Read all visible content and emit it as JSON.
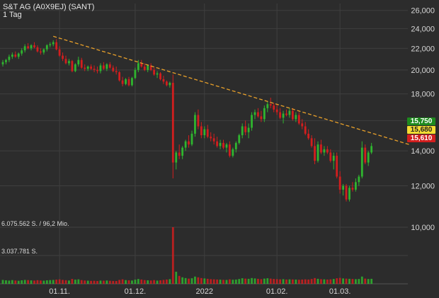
{
  "header": {
    "title": "S&T AG (A0X9EJ) (SANT)",
    "interval": "1 Tag"
  },
  "colors": {
    "background": "#2c2c2c",
    "grid": "#3f3f3f",
    "axis_text": "#d6d6d6",
    "up": "#2fb52f",
    "down": "#d21e1e",
    "trendline": "#e8a02a"
  },
  "price_tags": [
    {
      "label": "15,750",
      "bg": "#1e8a1e",
      "fg": "#ffffff"
    },
    {
      "label": "15,680",
      "bg": "#f5dc32",
      "fg": "#222222"
    },
    {
      "label": "15,610",
      "bg": "#d21e1e",
      "fg": "#ffffff"
    }
  ],
  "chart_data": {
    "type": "candlestick",
    "scale": "log",
    "title": "S&T AG (A0X9EJ) (SANT)",
    "interval": "1 Tag",
    "y_ticks": [
      "26,000",
      "24,000",
      "22,000",
      "20,000",
      "18,000",
      "16,000",
      "14,000",
      "12,000",
      "10,000"
    ],
    "y_tick_values": [
      26,
      24,
      22,
      20,
      18,
      16,
      14,
      12,
      10
    ],
    "ylim": [
      10,
      26.8
    ],
    "x_ticks": [
      "01.11.",
      "01.12.",
      "2022",
      "01.02.",
      "01.03."
    ],
    "x_tick_index": [
      18,
      42,
      64,
      87,
      107
    ],
    "volume_labels": [
      "6.075.562 S. / 96,2 Mio.",
      "3.037.781 S."
    ],
    "volume_max": 6075562,
    "trendline": {
      "from": {
        "i": 16,
        "price": 23.2
      },
      "to": {
        "i": 127,
        "price": 14.6
      }
    },
    "candles": [
      [
        20.5,
        20.9,
        20.3,
        20.7
      ],
      [
        20.7,
        21.0,
        20.5,
        20.9
      ],
      [
        20.9,
        21.4,
        20.7,
        21.2
      ],
      [
        21.2,
        21.6,
        21.0,
        21.4
      ],
      [
        21.4,
        21.7,
        21.1,
        21.2
      ],
      [
        21.2,
        21.6,
        21.0,
        21.5
      ],
      [
        21.5,
        22.0,
        21.3,
        21.8
      ],
      [
        21.8,
        22.4,
        21.6,
        22.2
      ],
      [
        22.2,
        22.5,
        21.9,
        22.0
      ],
      [
        22.0,
        22.4,
        21.8,
        22.3
      ],
      [
        22.3,
        22.6,
        22.0,
        22.1
      ],
      [
        22.1,
        22.3,
        21.6,
        21.7
      ],
      [
        21.7,
        22.0,
        21.4,
        21.6
      ],
      [
        21.6,
        22.0,
        21.4,
        21.9
      ],
      [
        21.9,
        22.4,
        21.7,
        22.3
      ],
      [
        22.3,
        22.6,
        22.1,
        22.4
      ],
      [
        22.4,
        22.8,
        22.2,
        22.6
      ],
      [
        22.6,
        22.9,
        21.8,
        21.9
      ],
      [
        21.9,
        22.2,
        21.2,
        21.3
      ],
      [
        21.3,
        21.6,
        20.8,
        21.0
      ],
      [
        21.0,
        21.3,
        20.5,
        20.6
      ],
      [
        20.6,
        21.0,
        20.4,
        20.8
      ],
      [
        20.8,
        20.9,
        19.8,
        19.9
      ],
      [
        19.9,
        20.6,
        19.8,
        20.5
      ],
      [
        20.5,
        21.2,
        20.3,
        20.9
      ],
      [
        20.9,
        21.1,
        20.1,
        20.2
      ],
      [
        20.2,
        20.5,
        19.9,
        20.1
      ],
      [
        20.1,
        20.4,
        19.9,
        20.3
      ],
      [
        20.3,
        20.5,
        20.0,
        20.1
      ],
      [
        20.1,
        20.4,
        19.8,
        20.0
      ],
      [
        20.0,
        20.3,
        19.7,
        19.9
      ],
      [
        19.9,
        20.6,
        19.7,
        20.4
      ],
      [
        20.4,
        20.7,
        20.0,
        20.1
      ],
      [
        20.1,
        20.6,
        19.9,
        20.5
      ],
      [
        20.5,
        20.7,
        20.1,
        20.2
      ],
      [
        20.2,
        20.4,
        19.8,
        19.9
      ],
      [
        19.9,
        20.3,
        19.6,
        19.8
      ],
      [
        19.8,
        19.9,
        19.0,
        19.1
      ],
      [
        19.1,
        19.4,
        18.6,
        18.8
      ],
      [
        18.8,
        19.3,
        18.7,
        19.2
      ],
      [
        19.2,
        19.4,
        18.6,
        18.7
      ],
      [
        18.7,
        19.4,
        18.6,
        19.3
      ],
      [
        19.3,
        20.2,
        19.2,
        20.0
      ],
      [
        20.0,
        20.9,
        19.8,
        20.6
      ],
      [
        20.6,
        20.9,
        20.2,
        20.3
      ],
      [
        20.3,
        20.6,
        19.9,
        20.0
      ],
      [
        20.0,
        20.5,
        19.8,
        20.4
      ],
      [
        20.4,
        20.6,
        19.9,
        20.0
      ],
      [
        20.0,
        20.2,
        19.5,
        19.6
      ],
      [
        19.6,
        19.9,
        19.3,
        19.7
      ],
      [
        19.7,
        19.8,
        19.1,
        19.2
      ],
      [
        19.2,
        19.5,
        18.8,
        19.0
      ],
      [
        19.0,
        19.1,
        18.6,
        18.7
      ],
      [
        18.7,
        19.0,
        18.5,
        18.9
      ],
      [
        18.9,
        19.6,
        12.4,
        13.3
      ],
      [
        13.3,
        14.0,
        12.9,
        13.9
      ],
      [
        13.9,
        14.4,
        13.5,
        13.7
      ],
      [
        13.7,
        14.3,
        13.5,
        14.2
      ],
      [
        14.2,
        14.7,
        14.0,
        14.6
      ],
      [
        14.6,
        15.0,
        14.2,
        14.4
      ],
      [
        14.4,
        15.3,
        14.3,
        15.1
      ],
      [
        15.1,
        16.6,
        14.9,
        16.4
      ],
      [
        16.4,
        16.8,
        15.4,
        15.6
      ],
      [
        15.6,
        15.9,
        14.8,
        15.0
      ],
      [
        15.0,
        15.6,
        14.8,
        15.4
      ],
      [
        15.4,
        15.7,
        14.8,
        14.9
      ],
      [
        14.9,
        15.2,
        14.6,
        14.8
      ],
      [
        14.8,
        15.1,
        14.4,
        14.6
      ],
      [
        14.6,
        14.9,
        14.2,
        14.3
      ],
      [
        14.3,
        14.7,
        14.1,
        14.5
      ],
      [
        14.5,
        14.7,
        14.1,
        14.2
      ],
      [
        14.2,
        14.5,
        13.9,
        14.4
      ],
      [
        14.4,
        14.6,
        13.6,
        13.7
      ],
      [
        13.7,
        14.2,
        13.6,
        14.1
      ],
      [
        14.1,
        14.6,
        13.9,
        14.5
      ],
      [
        14.5,
        15.1,
        14.4,
        15.0
      ],
      [
        15.0,
        15.8,
        14.8,
        15.6
      ],
      [
        15.6,
        16.0,
        15.0,
        15.2
      ],
      [
        15.2,
        15.8,
        14.8,
        15.5
      ],
      [
        15.5,
        16.6,
        15.3,
        16.4
      ],
      [
        16.4,
        16.8,
        16.1,
        16.6
      ],
      [
        16.6,
        16.9,
        16.2,
        16.3
      ],
      [
        16.3,
        16.7,
        15.9,
        16.1
      ],
      [
        16.1,
        17.1,
        15.9,
        16.9
      ],
      [
        16.9,
        17.4,
        16.6,
        17.2
      ],
      [
        17.2,
        17.7,
        16.9,
        17.1
      ],
      [
        17.1,
        17.3,
        16.6,
        16.8
      ],
      [
        16.8,
        17.2,
        16.4,
        16.6
      ],
      [
        16.6,
        16.9,
        16.1,
        16.2
      ],
      [
        16.2,
        16.7,
        15.8,
        16.5
      ],
      [
        16.5,
        16.8,
        16.3,
        16.4
      ],
      [
        16.4,
        16.9,
        16.2,
        16.7
      ],
      [
        16.7,
        16.9,
        16.0,
        16.1
      ],
      [
        16.1,
        16.6,
        15.9,
        16.4
      ],
      [
        16.4,
        16.6,
        15.7,
        15.8
      ],
      [
        15.8,
        16.1,
        15.4,
        15.6
      ],
      [
        15.6,
        15.9,
        15.0,
        15.1
      ],
      [
        15.1,
        15.4,
        14.7,
        14.8
      ],
      [
        14.8,
        15.0,
        14.2,
        14.3
      ],
      [
        14.3,
        14.8,
        13.2,
        13.4
      ],
      [
        13.4,
        14.6,
        13.3,
        14.4
      ],
      [
        14.4,
        14.7,
        13.8,
        13.9
      ],
      [
        13.9,
        14.3,
        13.7,
        14.1
      ],
      [
        14.1,
        14.3,
        13.8,
        13.9
      ],
      [
        13.9,
        14.1,
        13.3,
        13.4
      ],
      [
        13.4,
        13.9,
        12.9,
        13.7
      ],
      [
        13.7,
        13.9,
        12.4,
        12.5
      ],
      [
        12.5,
        12.8,
        11.6,
        11.8
      ],
      [
        11.8,
        12.1,
        11.5,
        12.0
      ],
      [
        12.0,
        12.1,
        11.2,
        11.3
      ],
      [
        11.3,
        12.0,
        11.2,
        11.9
      ],
      [
        11.9,
        12.2,
        11.7,
        11.8
      ],
      [
        11.8,
        12.4,
        11.7,
        12.2
      ],
      [
        12.2,
        12.6,
        12.0,
        12.5
      ],
      [
        12.5,
        14.6,
        12.4,
        14.2
      ],
      [
        14.2,
        14.4,
        13.2,
        13.3
      ],
      [
        13.3,
        14.0,
        13.1,
        13.9
      ],
      [
        13.9,
        14.5,
        13.8,
        14.3
      ]
    ],
    "volume": [
      420000,
      380000,
      350000,
      400000,
      360000,
      330000,
      380000,
      420000,
      400000,
      370000,
      350000,
      390000,
      360000,
      340000,
      380000,
      400000,
      420000,
      450000,
      480000,
      420000,
      390000,
      360000,
      520000,
      450000,
      480000,
      400000,
      360000,
      340000,
      320000,
      330000,
      310000,
      350000,
      340000,
      360000,
      330000,
      310000,
      300000,
      420000,
      480000,
      400000,
      380000,
      360000,
      450000,
      520000,
      460000,
      400000,
      380000,
      360000,
      400000,
      350000,
      380000,
      420000,
      460000,
      500000,
      6075562,
      1300000,
      850000,
      700000,
      620000,
      560000,
      600000,
      780000,
      700000,
      620000,
      580000,
      540000,
      500000,
      480000,
      460000,
      450000,
      430000,
      420000,
      480000,
      440000,
      460000,
      520000,
      600000,
      560000,
      540000,
      620000,
      580000,
      540000,
      500000,
      560000,
      600000,
      560000,
      520000,
      500000,
      480000,
      500000,
      460000,
      480000,
      470000,
      460000,
      440000,
      460000,
      480000,
      460000,
      520000,
      620000,
      540000,
      500000,
      480000,
      460000,
      480000,
      520000,
      600000,
      640000,
      580000,
      560000,
      540000,
      520000,
      500000,
      520000,
      780000,
      560000,
      520000,
      540000
    ]
  }
}
